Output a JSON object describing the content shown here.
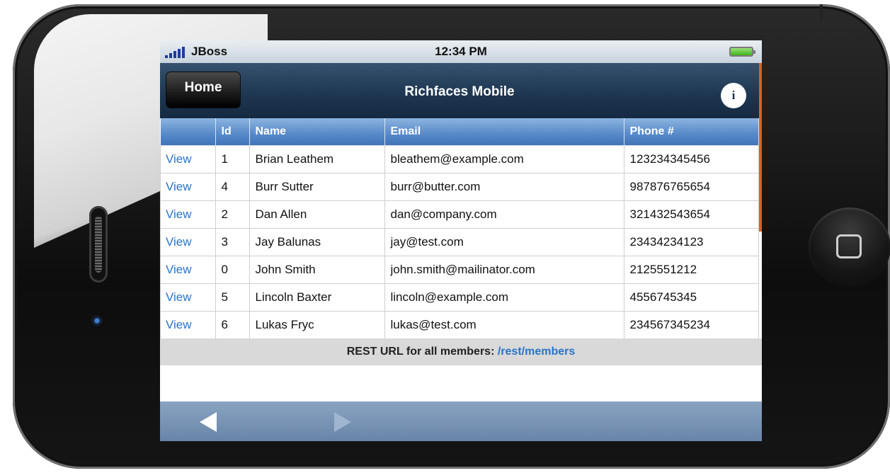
{
  "statusbar": {
    "carrier": "JBoss",
    "time": "12:34 PM",
    "signal_icon": "signal-bars-icon",
    "battery_icon": "battery-icon"
  },
  "navbar": {
    "home_label": "Home",
    "title": "Richfaces Mobile",
    "info_label": "i"
  },
  "table": {
    "headers": [
      "",
      "Id",
      "Name",
      "Email",
      "Phone #"
    ],
    "rows": [
      {
        "action": "View",
        "id": "1",
        "name": "Brian Leathem",
        "email": "bleathem@example.com",
        "phone": "123234345456"
      },
      {
        "action": "View",
        "id": "4",
        "name": "Burr Sutter",
        "email": "burr@butter.com",
        "phone": "987876765654"
      },
      {
        "action": "View",
        "id": "2",
        "name": "Dan Allen",
        "email": "dan@company.com",
        "phone": "321432543654"
      },
      {
        "action": "View",
        "id": "3",
        "name": "Jay Balunas",
        "email": "jay@test.com",
        "phone": "23434234123"
      },
      {
        "action": "View",
        "id": "0",
        "name": "John Smith",
        "email": "john.smith@mailinator.com",
        "phone": "2125551212"
      },
      {
        "action": "View",
        "id": "5",
        "name": "Lincoln Baxter",
        "email": "lincoln@example.com",
        "phone": "4556745345"
      },
      {
        "action": "View",
        "id": "6",
        "name": "Lukas Fryc",
        "email": "lukas@test.com",
        "phone": "234567345234"
      }
    ]
  },
  "rest": {
    "label": "REST URL for all members:",
    "link": "/rest/members"
  },
  "toolbar": {
    "back_icon": "back-arrow-icon",
    "forward_icon": "forward-arrow-icon"
  },
  "colors": {
    "nav_bg": "#1d3550",
    "header_blue": "#5a8ccb",
    "link_blue": "#2a73c8",
    "accent_orange": "#d9621a"
  }
}
